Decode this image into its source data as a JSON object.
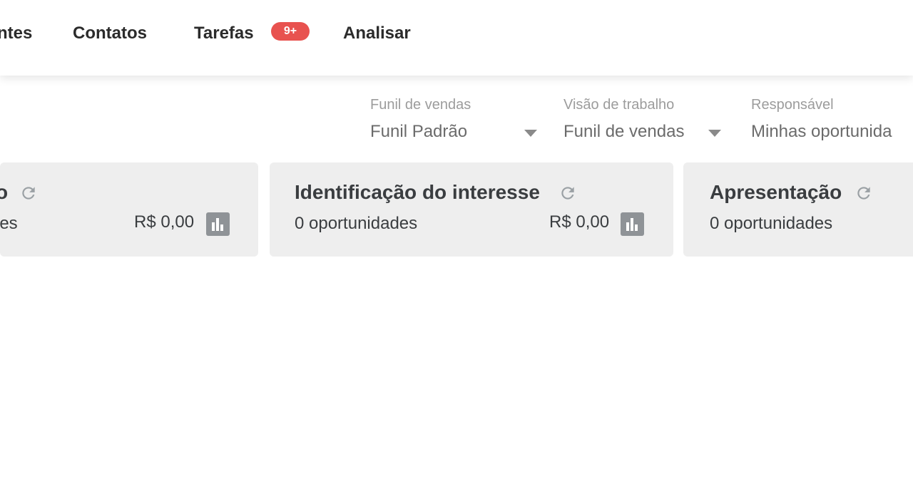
{
  "nav": {
    "items": [
      {
        "label": "ntes"
      },
      {
        "label": "Contatos"
      },
      {
        "label": "Tarefas"
      },
      {
        "label": "Analisar"
      }
    ],
    "tasks_badge": "9+"
  },
  "filters": {
    "funnel": {
      "label": "Funil de vendas",
      "value": "Funil Padrão"
    },
    "work_view": {
      "label": "Visão de trabalho",
      "value": "Funil de vendas"
    },
    "owner": {
      "label": "Responsável",
      "value": "Minhas oportunida"
    }
  },
  "stages": [
    {
      "title": "o",
      "count": "les",
      "value": "R$ 0,00"
    },
    {
      "title": "Identificação do interesse",
      "count": "0 oportunidades",
      "value": "R$ 0,00"
    },
    {
      "title": "Apresentação",
      "count": "0 oportunidades",
      "value": ""
    }
  ],
  "colors": {
    "badge": "#e8524f",
    "card_bg": "#eeeeee",
    "icon_gray": "#8f9397"
  }
}
